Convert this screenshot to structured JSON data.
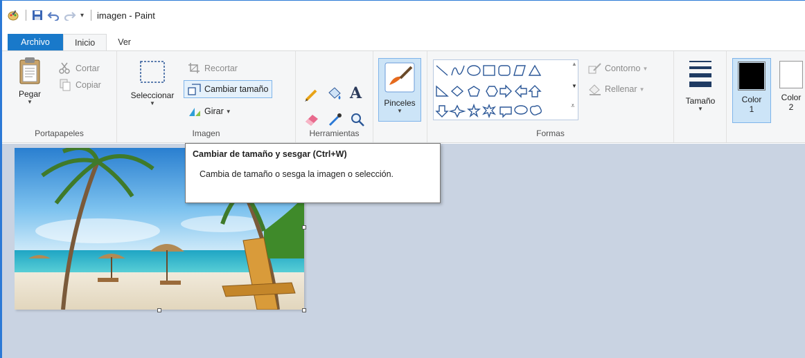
{
  "title_bar": {
    "title": "imagen - Paint"
  },
  "tabs": {
    "file": "Archivo",
    "home": "Inicio",
    "view": "Ver"
  },
  "clipboard": {
    "paste": "Pegar",
    "cut": "Cortar",
    "copy": "Copiar",
    "label": "Portapapeles"
  },
  "image": {
    "select": "Seleccionar",
    "crop": "Recortar",
    "resize": "Cambiar tamaño",
    "rotate": "Girar",
    "label": "Imagen"
  },
  "tools": {
    "label": "Herramientas"
  },
  "brushes": {
    "label": "Pinceles"
  },
  "shapes": {
    "outline": "Contorno",
    "fill": "Rellenar",
    "label": "Formas"
  },
  "size": {
    "label": "Tamaño"
  },
  "colors": {
    "color1": "Color",
    "color1_num": "1",
    "color2": "Color",
    "color2_num": "2",
    "color1_value": "#000000",
    "color2_value": "#ffffff"
  },
  "tooltip": {
    "title": "Cambiar de tamaño y sesgar (Ctrl+W)",
    "body": "Cambia de tamaño o sesga la imagen o selección."
  },
  "theme": {
    "accent": "#1979ca",
    "ribbon_bg": "#f5f6f7",
    "canvas_bg": "#c9d3e2"
  }
}
